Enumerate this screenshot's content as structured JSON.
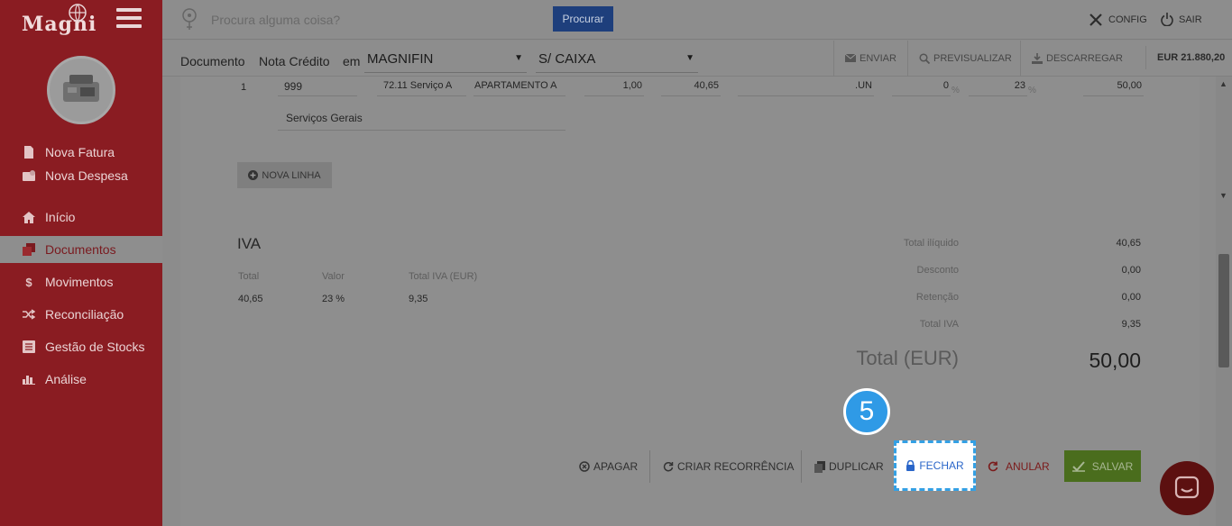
{
  "brand": {
    "name": "Magni"
  },
  "sidebar": {
    "items": [
      {
        "label": "Nova Fatura",
        "icon": "file-icon"
      },
      {
        "label": "Nova Despesa",
        "icon": "expense-icon"
      },
      {
        "label": "Início",
        "icon": "home-icon"
      },
      {
        "label": "Documentos",
        "icon": "documents-icon",
        "active": true
      },
      {
        "label": "Movimentos",
        "icon": "dollar-icon"
      },
      {
        "label": "Reconciliação",
        "icon": "shuffle-icon"
      },
      {
        "label": "Gestão de Stocks",
        "icon": "stocks-icon"
      },
      {
        "label": "Análise",
        "icon": "bar-chart-icon"
      }
    ]
  },
  "topbar": {
    "search_placeholder": "Procura alguma coisa?",
    "search_button": "Procurar",
    "config": "CONFIG",
    "logout": "SAIR"
  },
  "docbar": {
    "label_document": "Documento",
    "doc_type": "Nota Crédito",
    "label_in": "em",
    "company": "MAGNIFIN",
    "cash": "S/ CAIXA",
    "send": "ENVIAR",
    "preview": "PREVISUALIZAR",
    "download": "DESCARREGAR",
    "total": "EUR 21.880,20"
  },
  "line": {
    "index": "1",
    "code": "999",
    "account": "72.11 Serviço A",
    "description": "APARTAMENTO A",
    "quantity": "1,00",
    "price": "40,65",
    "unit": ".UN",
    "discount": "0",
    "discount_unit": "%",
    "vat": "23",
    "vat_unit": "%",
    "total": "50,00",
    "notes": "Serviços Gerais"
  },
  "new_line_label": "NOVA LINHA",
  "iva": {
    "title": "IVA",
    "headers": [
      "Total",
      "Valor",
      "Total IVA (EUR)"
    ],
    "row": [
      "40,65",
      "23 %",
      "9,35"
    ]
  },
  "summary": {
    "rows": [
      {
        "label": "Total ilíquido",
        "value": "40,65"
      },
      {
        "label": "Desconto",
        "value": "0,00"
      },
      {
        "label": "Retenção",
        "value": "0,00"
      },
      {
        "label": "Total IVA",
        "value": "9,35"
      }
    ],
    "total_label": "Total (EUR)",
    "total_value": "50,00"
  },
  "step": "5",
  "actions": {
    "delete": "APAGAR",
    "recurrence": "CRIAR RECORRÊNCIA",
    "duplicate": "DUPLICAR",
    "close": "FECHAR",
    "void": "ANULAR",
    "save": "SALVAR"
  },
  "colors": {
    "sidebar": "#8a1c22",
    "highlight": "#34a0e4",
    "save": "#4a6d1d"
  }
}
